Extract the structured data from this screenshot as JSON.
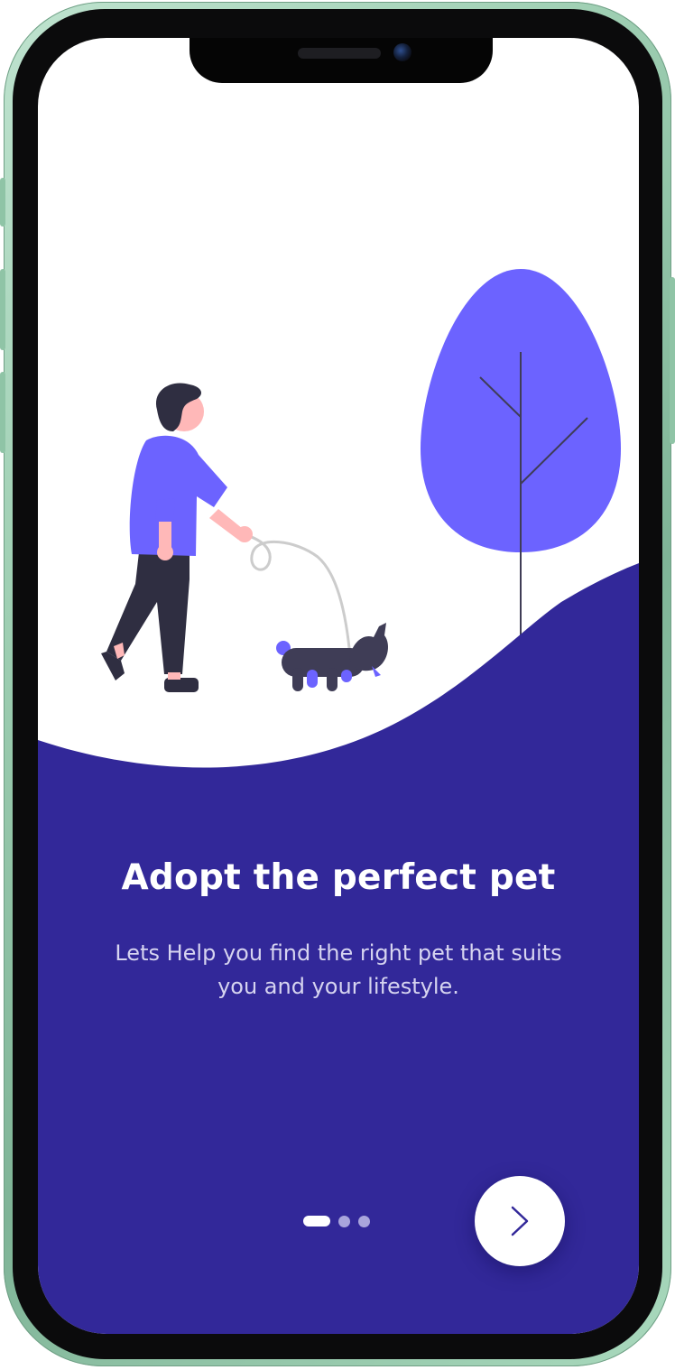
{
  "onboarding": {
    "title": "Adopt the perfect pet",
    "subtitle": "Lets Help you find the right pet that suits you and your lifestyle.",
    "pagination": {
      "total": 3,
      "current": 1
    },
    "next_button_icon": "chevron-right-icon"
  },
  "theme": {
    "primary_dark": "#322899",
    "accent": "#6c63ff",
    "figure_dark": "#2f2e41",
    "skin": "#ffb8b8",
    "leash": "#cccccc",
    "frame_green": "#9fcfb3"
  },
  "illustration": {
    "name": "man-walking-dog",
    "elements": [
      "person",
      "dog",
      "leash",
      "tree"
    ]
  }
}
